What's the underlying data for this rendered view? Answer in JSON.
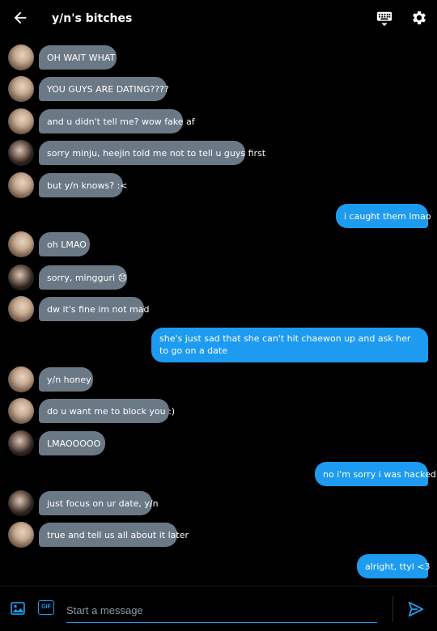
{
  "header": {
    "title": "y/n's bitches"
  },
  "messages": [
    {
      "dir": "in",
      "avatar": "light",
      "text": "OH WAIT WHAT"
    },
    {
      "dir": "in",
      "avatar": "light",
      "text": "YOU GUYS ARE DATING????"
    },
    {
      "dir": "in",
      "avatar": "light",
      "text": "and u didn't tell me? wow fake af"
    },
    {
      "dir": "in",
      "avatar": "dark",
      "text": "sorry minju, heejin told me not to tell u guys first"
    },
    {
      "dir": "in",
      "avatar": "light",
      "text": "but y/n knows? :<"
    },
    {
      "dir": "out",
      "text": "i caught them lmao"
    },
    {
      "dir": "in",
      "avatar": "light",
      "text": "oh LMAO"
    },
    {
      "dir": "in",
      "avatar": "dark",
      "text": "sorry, mingguri 😞"
    },
    {
      "dir": "in",
      "avatar": "light",
      "text": "dw it's fine im not mad"
    },
    {
      "dir": "out",
      "text": "she's just sad that she can't hit chaewon up and ask her to go on a date"
    },
    {
      "dir": "in",
      "avatar": "light",
      "text": "y/n honey"
    },
    {
      "dir": "in",
      "avatar": "light",
      "text": "do u want me to block you :)"
    },
    {
      "dir": "in",
      "avatar": "dark",
      "text": "LMAOOOOO"
    },
    {
      "dir": "out",
      "text": "no i'm sorry i was hacked"
    },
    {
      "dir": "in",
      "avatar": "dark",
      "text": "just focus on ur date, y/n"
    },
    {
      "dir": "in",
      "avatar": "light",
      "text": "true and tell us all about it later"
    },
    {
      "dir": "out",
      "text": "alright, ttyl <3"
    }
  ],
  "composer": {
    "placeholder": "Start a message",
    "gif_label": "GIF"
  },
  "colors": {
    "accent": "#1d9bf0",
    "incoming_bubble": "#6b7886",
    "background": "#000000"
  }
}
